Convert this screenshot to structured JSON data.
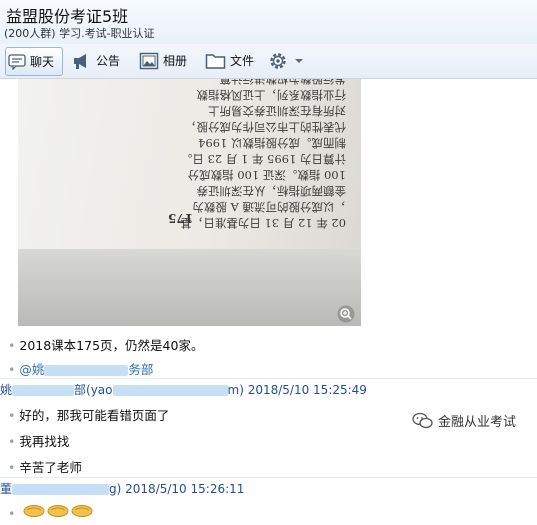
{
  "header": {
    "title": "益盟股份考证5班",
    "subtitle": "(200人群) 学习.考试-职业认证"
  },
  "toolbar": {
    "tabs": [
      {
        "label": "聊天",
        "icon": "chat-icon",
        "active": true
      },
      {
        "label": "公告",
        "icon": "announcement-icon",
        "active": false
      },
      {
        "label": "相册",
        "icon": "photo-album-icon",
        "active": false
      },
      {
        "label": "文件",
        "icon": "folder-icon",
        "active": false
      }
    ],
    "settings_icon": "gear-icon",
    "more_icon": "chevron-down-icon"
  },
  "photo": {
    "lines": [
      "发行股数为权数进行计算。",
      "行业指数系列，上证风格指数",
      "",
      "对所有在深圳证券交易所上",
      "代表性的上市公司作为成分股，",
      "制而成。成分股指数以 1994",
      "计算日为 1995 年 1 月 23 日。",
      "",
      "100 指数。深证 100 指数成分",
      "金额两项指标，从在深圳证券",
      "，以成分股的可流通 A 股数为",
      "02 年 12 月 31 日为基准日，基"
    ],
    "page_number": "175"
  },
  "messages": [
    {
      "text": "2018课本175页，仍然是40家。"
    },
    {
      "mention_prefix": "@姚",
      "mention_suffix": "务部"
    },
    {
      "sender_prefix": "姚",
      "sender_mid": "部(yao",
      "sender_tail": "m)",
      "timestamp": "2018/5/10 15:25:49"
    },
    {
      "text": "好的，那我可能看错页面了"
    },
    {
      "text": "我再找找"
    },
    {
      "text": "辛苦了老师"
    },
    {
      "sender_prefix": "董",
      "sender_tail": "g)",
      "timestamp": "2018/5/10 15:26:11"
    }
  ],
  "watermark": {
    "label": "金融从业考试",
    "icon": "wechat-icon"
  }
}
